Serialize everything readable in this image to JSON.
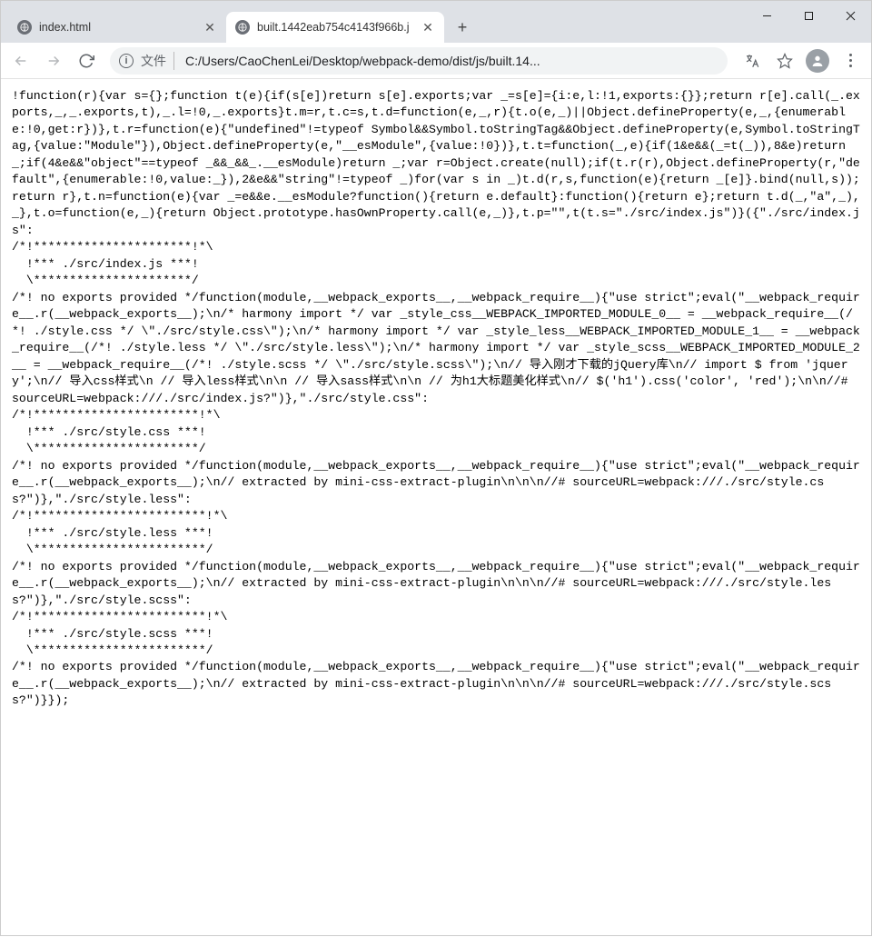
{
  "tabs": [
    {
      "label": "index.html",
      "active": false
    },
    {
      "label": "built.1442eab754c4143f966b.j",
      "active": true
    }
  ],
  "address": {
    "prefix": "文件",
    "url": "C:/Users/CaoChenLei/Desktop/webpack-demo/dist/js/built.14..."
  },
  "page_text": "!function(r){var s={};function t(e){if(s[e])return s[e].exports;var _=s[e]={i:e,l:!1,exports:{}};return r[e].call(_.exports,_,_.exports,t),_.l=!0,_.exports}t.m=r,t.c=s,t.d=function(e,_,r){t.o(e,_)||Object.defineProperty(e,_,{enumerable:!0,get:r})},t.r=function(e){\"undefined\"!=typeof Symbol&&Symbol.toStringTag&&Object.defineProperty(e,Symbol.toStringTag,{value:\"Module\"}),Object.defineProperty(e,\"__esModule\",{value:!0})},t.t=function(_,e){if(1&e&&(_=t(_)),8&e)return _;if(4&e&&\"object\"==typeof _&&_&&_.__esModule)return _;var r=Object.create(null);if(t.r(r),Object.defineProperty(r,\"default\",{enumerable:!0,value:_}),2&e&&\"string\"!=typeof _)for(var s in _)t.d(r,s,function(e){return _[e]}.bind(null,s));return r},t.n=function(e){var _=e&&e.__esModule?function(){return e.default}:function(){return e};return t.d(_,\"a\",_),_},t.o=function(e,_){return Object.prototype.hasOwnProperty.call(e,_)},t.p=\"\",t(t.s=\"./src/index.js\")}({\"./src/index.js\":\n/*!**********************!*\\\n  !*** ./src/index.js ***!\n  \\**********************/\n/*! no exports provided */function(module,__webpack_exports__,__webpack_require__){\"use strict\";eval(\"__webpack_require__.r(__webpack_exports__);\\n/* harmony import */ var _style_css__WEBPACK_IMPORTED_MODULE_0__ = __webpack_require__(/*! ./style.css */ \\\"./src/style.css\\\");\\n/* harmony import */ var _style_less__WEBPACK_IMPORTED_MODULE_1__ = __webpack_require__(/*! ./style.less */ \\\"./src/style.less\\\");\\n/* harmony import */ var _style_scss__WEBPACK_IMPORTED_MODULE_2__ = __webpack_require__(/*! ./style.scss */ \\\"./src/style.scss\\\");\\n// 导入刚才下载的jQuery库\\n// import $ from 'jquery';\\n// 导入css样式\\n // 导入less样式\\n\\n // 导入sass样式\\n\\n // 为h1大标题美化样式\\n// $('h1').css('color', 'red');\\n\\n//# sourceURL=webpack:///./src/index.js?\")},\"./src/style.css\":\n/*!***********************!*\\\n  !*** ./src/style.css ***!\n  \\***********************/\n/*! no exports provided */function(module,__webpack_exports__,__webpack_require__){\"use strict\";eval(\"__webpack_require__.r(__webpack_exports__);\\n// extracted by mini-css-extract-plugin\\n\\n\\n//# sourceURL=webpack:///./src/style.css?\")},\"./src/style.less\":\n/*!************************!*\\\n  !*** ./src/style.less ***!\n  \\************************/\n/*! no exports provided */function(module,__webpack_exports__,__webpack_require__){\"use strict\";eval(\"__webpack_require__.r(__webpack_exports__);\\n// extracted by mini-css-extract-plugin\\n\\n\\n//# sourceURL=webpack:///./src/style.less?\")},\"./src/style.scss\":\n/*!************************!*\\\n  !*** ./src/style.scss ***!\n  \\************************/\n/*! no exports provided */function(module,__webpack_exports__,__webpack_require__){\"use strict\";eval(\"__webpack_require__.r(__webpack_exports__);\\n// extracted by mini-css-extract-plugin\\n\\n\\n//# sourceURL=webpack:///./src/style.scss?\")}});"
}
